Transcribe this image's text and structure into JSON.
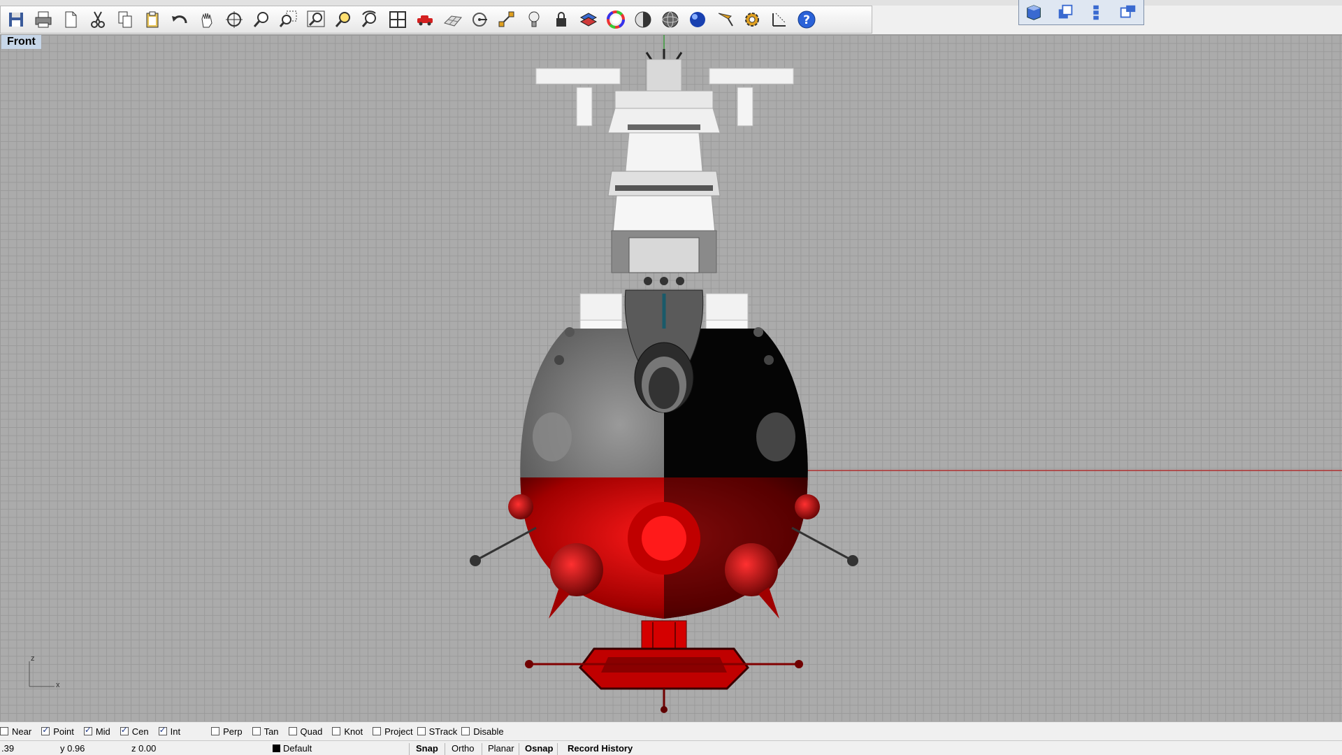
{
  "toolbar": {
    "icons": [
      "save-icon",
      "print-icon",
      "new-icon",
      "cut-icon",
      "copy-icon",
      "paste-icon",
      "undo-icon",
      "pan-icon",
      "rotate-view-icon",
      "zoom-icon",
      "zoom-window-icon",
      "zoom-extents-icon",
      "zoom-selected-icon",
      "undo-view-icon",
      "four-views-icon",
      "car-icon",
      "grid-icon",
      "point-icon",
      "transform-icon",
      "light-bulb-icon",
      "lock-icon",
      "layer-icon",
      "color-wheel-icon",
      "shaded-sphere-icon",
      "render-sphere-icon",
      "blue-sphere-icon",
      "pencil-icon",
      "settings-gear-icon",
      "dimension-icon",
      "help-icon"
    ],
    "viewport_tabs": [
      "perspective-view-icon",
      "top-view-icon",
      "front-view-icon",
      "right-view-icon"
    ]
  },
  "viewport": {
    "title": "Front",
    "axis_z": "z",
    "axis_x": "x"
  },
  "osnap": {
    "items": [
      {
        "label": "Near",
        "checked": false
      },
      {
        "label": "Point",
        "checked": true
      },
      {
        "label": "Mid",
        "checked": true
      },
      {
        "label": "Cen",
        "checked": true
      },
      {
        "label": "Int",
        "checked": true
      },
      {
        "label": "Perp",
        "checked": false
      },
      {
        "label": "Tan",
        "checked": false
      },
      {
        "label": "Quad",
        "checked": false
      },
      {
        "label": "Knot",
        "checked": false
      },
      {
        "label": "Project",
        "checked": false
      },
      {
        "label": "STrack",
        "checked": false
      },
      {
        "label": "Disable",
        "checked": false
      }
    ]
  },
  "status": {
    "x_coord": ".39",
    "y_coord": "y 0.96",
    "z_coord": "z 0.00",
    "layer": "Default",
    "buttons": [
      "Snap",
      "Ortho",
      "Planar",
      "Osnap",
      "Record History"
    ]
  },
  "colors": {
    "grid_bg": "#ababab",
    "x_axis": "#c0392b",
    "hull_red": "#e00000",
    "teal": "#2aa6a6"
  }
}
